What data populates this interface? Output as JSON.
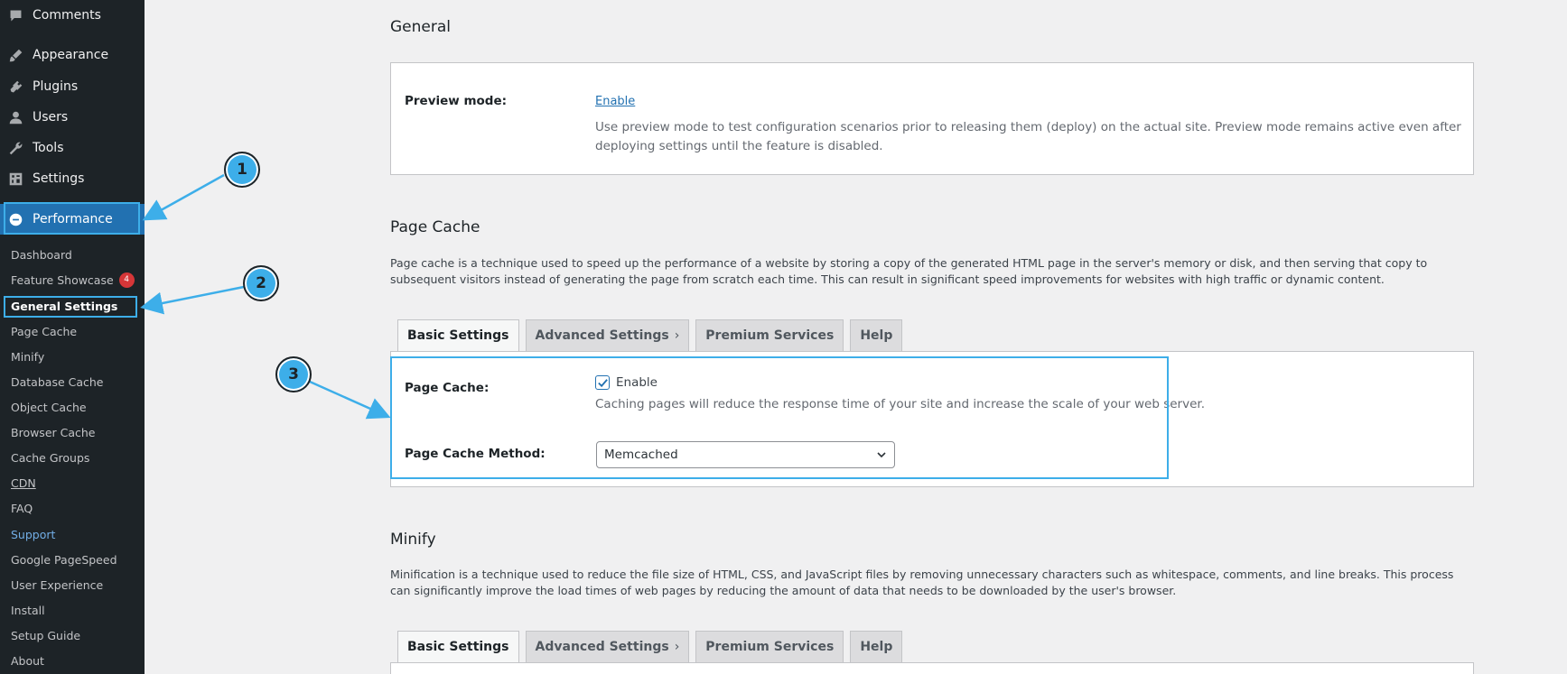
{
  "sidebar": {
    "menu": {
      "comments": "Comments",
      "appearance": "Appearance",
      "plugins": "Plugins",
      "users": "Users",
      "tools": "Tools",
      "settings": "Settings",
      "performance": "Performance"
    },
    "submenu": {
      "dashboard": "Dashboard",
      "feature_showcase": "Feature Showcase",
      "feature_showcase_badge": "4",
      "general_settings": "General Settings",
      "page_cache": "Page Cache",
      "minify": "Minify",
      "database_cache": "Database Cache",
      "object_cache": "Object Cache",
      "browser_cache": "Browser Cache",
      "cache_groups": "Cache Groups",
      "cdn": "CDN",
      "faq": "FAQ",
      "support": "Support",
      "google_pagespeed": "Google PageSpeed",
      "user_experience": "User Experience",
      "install": "Install",
      "setup_guide": "Setup Guide",
      "about": "About"
    }
  },
  "general": {
    "title": "General",
    "preview_label": "Preview mode:",
    "preview_link": "Enable",
    "preview_desc": "Use preview mode to test configuration scenarios prior to releasing them (deploy) on the actual site. Preview mode remains active even after deploying settings until the feature is disabled."
  },
  "page_cache": {
    "title": "Page Cache",
    "description": "Page cache is a technique used to speed up the performance of a website by storing a copy of the generated HTML page in the server's memory or disk, and then serving that copy to subsequent visitors instead of generating the page from scratch each time. This can result in significant speed improvements for websites with high traffic or dynamic content.",
    "tabs": [
      "Basic Settings",
      "Advanced Settings",
      "Premium Services",
      "Help"
    ],
    "page_cache_label": "Page Cache:",
    "enable_label": "Enable",
    "enable_checked": true,
    "enable_desc": "Caching pages will reduce the response time of your site and increase the scale of your web server.",
    "method_label": "Page Cache Method:",
    "method_value": "Memcached"
  },
  "minify": {
    "title": "Minify",
    "description": "Minification is a technique used to reduce the file size of HTML, CSS, and JavaScript files by removing unnecessary characters such as whitespace, comments, and line breaks. This process can significantly improve the load times of web pages by reducing the amount of data that needs to be downloaded by the user's browser.",
    "tabs": [
      "Basic Settings",
      "Advanced Settings",
      "Premium Services",
      "Help"
    ]
  },
  "callouts": [
    "1",
    "2",
    "3"
  ],
  "colors": {
    "sidebar_bg": "#1d2327",
    "accent": "#2271b1",
    "callout": "#3daee9"
  }
}
